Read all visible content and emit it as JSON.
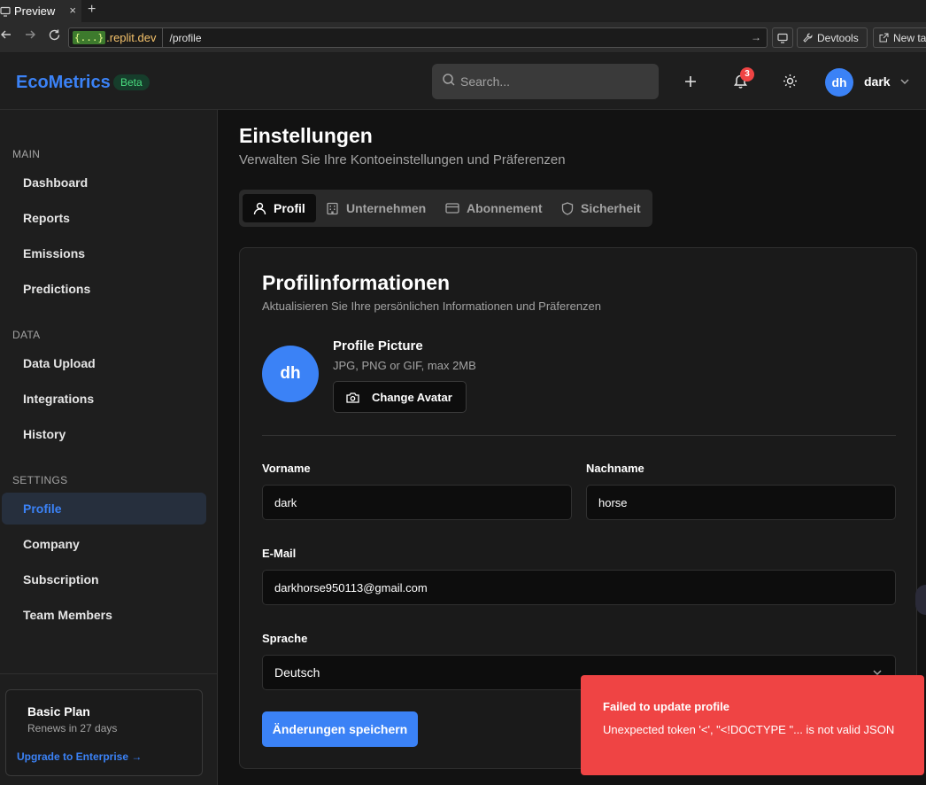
{
  "browser": {
    "tab_title": "Preview",
    "tab_close": "×",
    "new_tab": "+",
    "url_host_badge": "{...}",
    "url_host": ".replit.dev",
    "url_path": "/profile",
    "devtools_label": "Devtools",
    "newtab_label": "New ta"
  },
  "header": {
    "logo": "EcoMetrics",
    "badge": "Beta",
    "search_placeholder": "Search...",
    "notification_count": "3",
    "avatar_initials": "dh",
    "username": "dark"
  },
  "sidebar": {
    "sections": [
      {
        "title": "MAIN",
        "items": [
          "Dashboard",
          "Reports",
          "Emissions",
          "Predictions"
        ]
      },
      {
        "title": "DATA",
        "items": [
          "Data Upload",
          "Integrations",
          "History"
        ]
      },
      {
        "title": "SETTINGS",
        "items": [
          "Profile",
          "Company",
          "Subscription",
          "Team Members"
        ]
      }
    ],
    "active_item": "Profile",
    "plan": {
      "name": "Basic Plan",
      "renewal": "Renews in 27 days",
      "upgrade_link": "Upgrade to Enterprise →"
    }
  },
  "page": {
    "title": "Einstellungen",
    "subtitle": "Verwalten Sie Ihre Kontoeinstellungen und Präferenzen",
    "tabs": [
      {
        "label": "Profil",
        "icon": "user-icon",
        "active": true
      },
      {
        "label": "Unternehmen",
        "icon": "building-icon",
        "active": false
      },
      {
        "label": "Abonnement",
        "icon": "credit-card-icon",
        "active": false
      },
      {
        "label": "Sicherheit",
        "icon": "shield-icon",
        "active": false
      }
    ]
  },
  "profile_card": {
    "title": "Profilinformationen",
    "subtitle": "Aktualisieren Sie Ihre persönlichen Informationen und Präferenzen",
    "avatar_initials": "dh",
    "picture_title": "Profile Picture",
    "picture_hint": "JPG, PNG or GIF, max 2MB",
    "change_avatar_label": "Change Avatar",
    "fields": {
      "first_name_label": "Vorname",
      "first_name_value": "dark",
      "last_name_label": "Nachname",
      "last_name_value": "horse",
      "email_label": "E-Mail",
      "email_value": "darkhorse950113@gmail.com",
      "language_label": "Sprache",
      "language_value": "Deutsch"
    },
    "save_label": "Änderungen speichern"
  },
  "toast": {
    "title": "Failed to update profile",
    "message": "Unexpected token '<', \"<!DOCTYPE \"... is not valid JSON"
  },
  "colors": {
    "accent": "#3b82f6",
    "error": "#ef4444",
    "beta_text": "#4ade80",
    "background": "#121212",
    "surface": "#1e1e1e"
  }
}
